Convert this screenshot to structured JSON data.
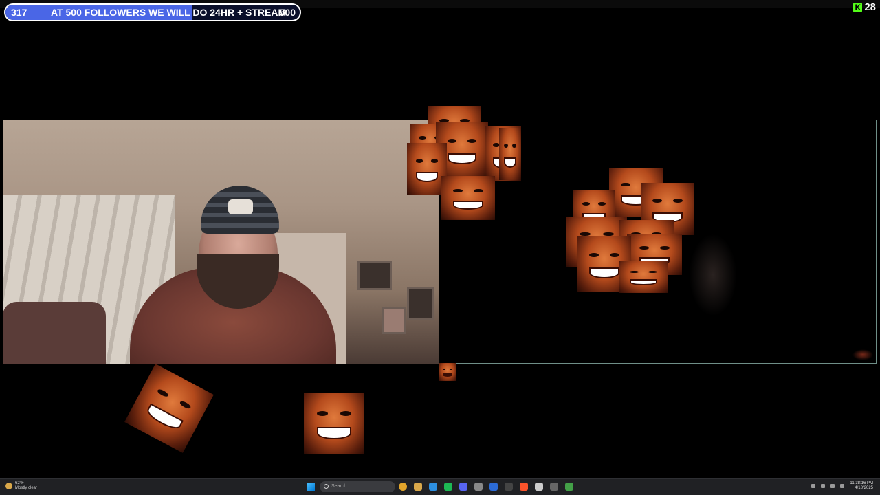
{
  "follower_goal": {
    "current": "317",
    "message": "AT 500 FOLLOWERS WE WILL DO 24HR + STREAM",
    "target": "500",
    "progress_fraction": 0.634,
    "fill_color": "#4a66e6"
  },
  "viewers": {
    "platform_icon": "kick-logo-icon",
    "count": "28",
    "accent": "#53fc18"
  },
  "taskbar": {
    "weather_temp": "62°F",
    "weather_desc": "Mostly clear",
    "search_placeholder": "Search",
    "clock_time": "11:38:16 PM",
    "clock_date": "4/18/2025",
    "apps": [
      "chrome-icon",
      "file-explorer-icon",
      "edge-icon",
      "spotify-icon",
      "discord-icon",
      "obs-icon",
      "photoshop-icon",
      "terminal-icon",
      "brave-icon",
      "steam-icon",
      "app-icon",
      "xbox-icon"
    ]
  }
}
